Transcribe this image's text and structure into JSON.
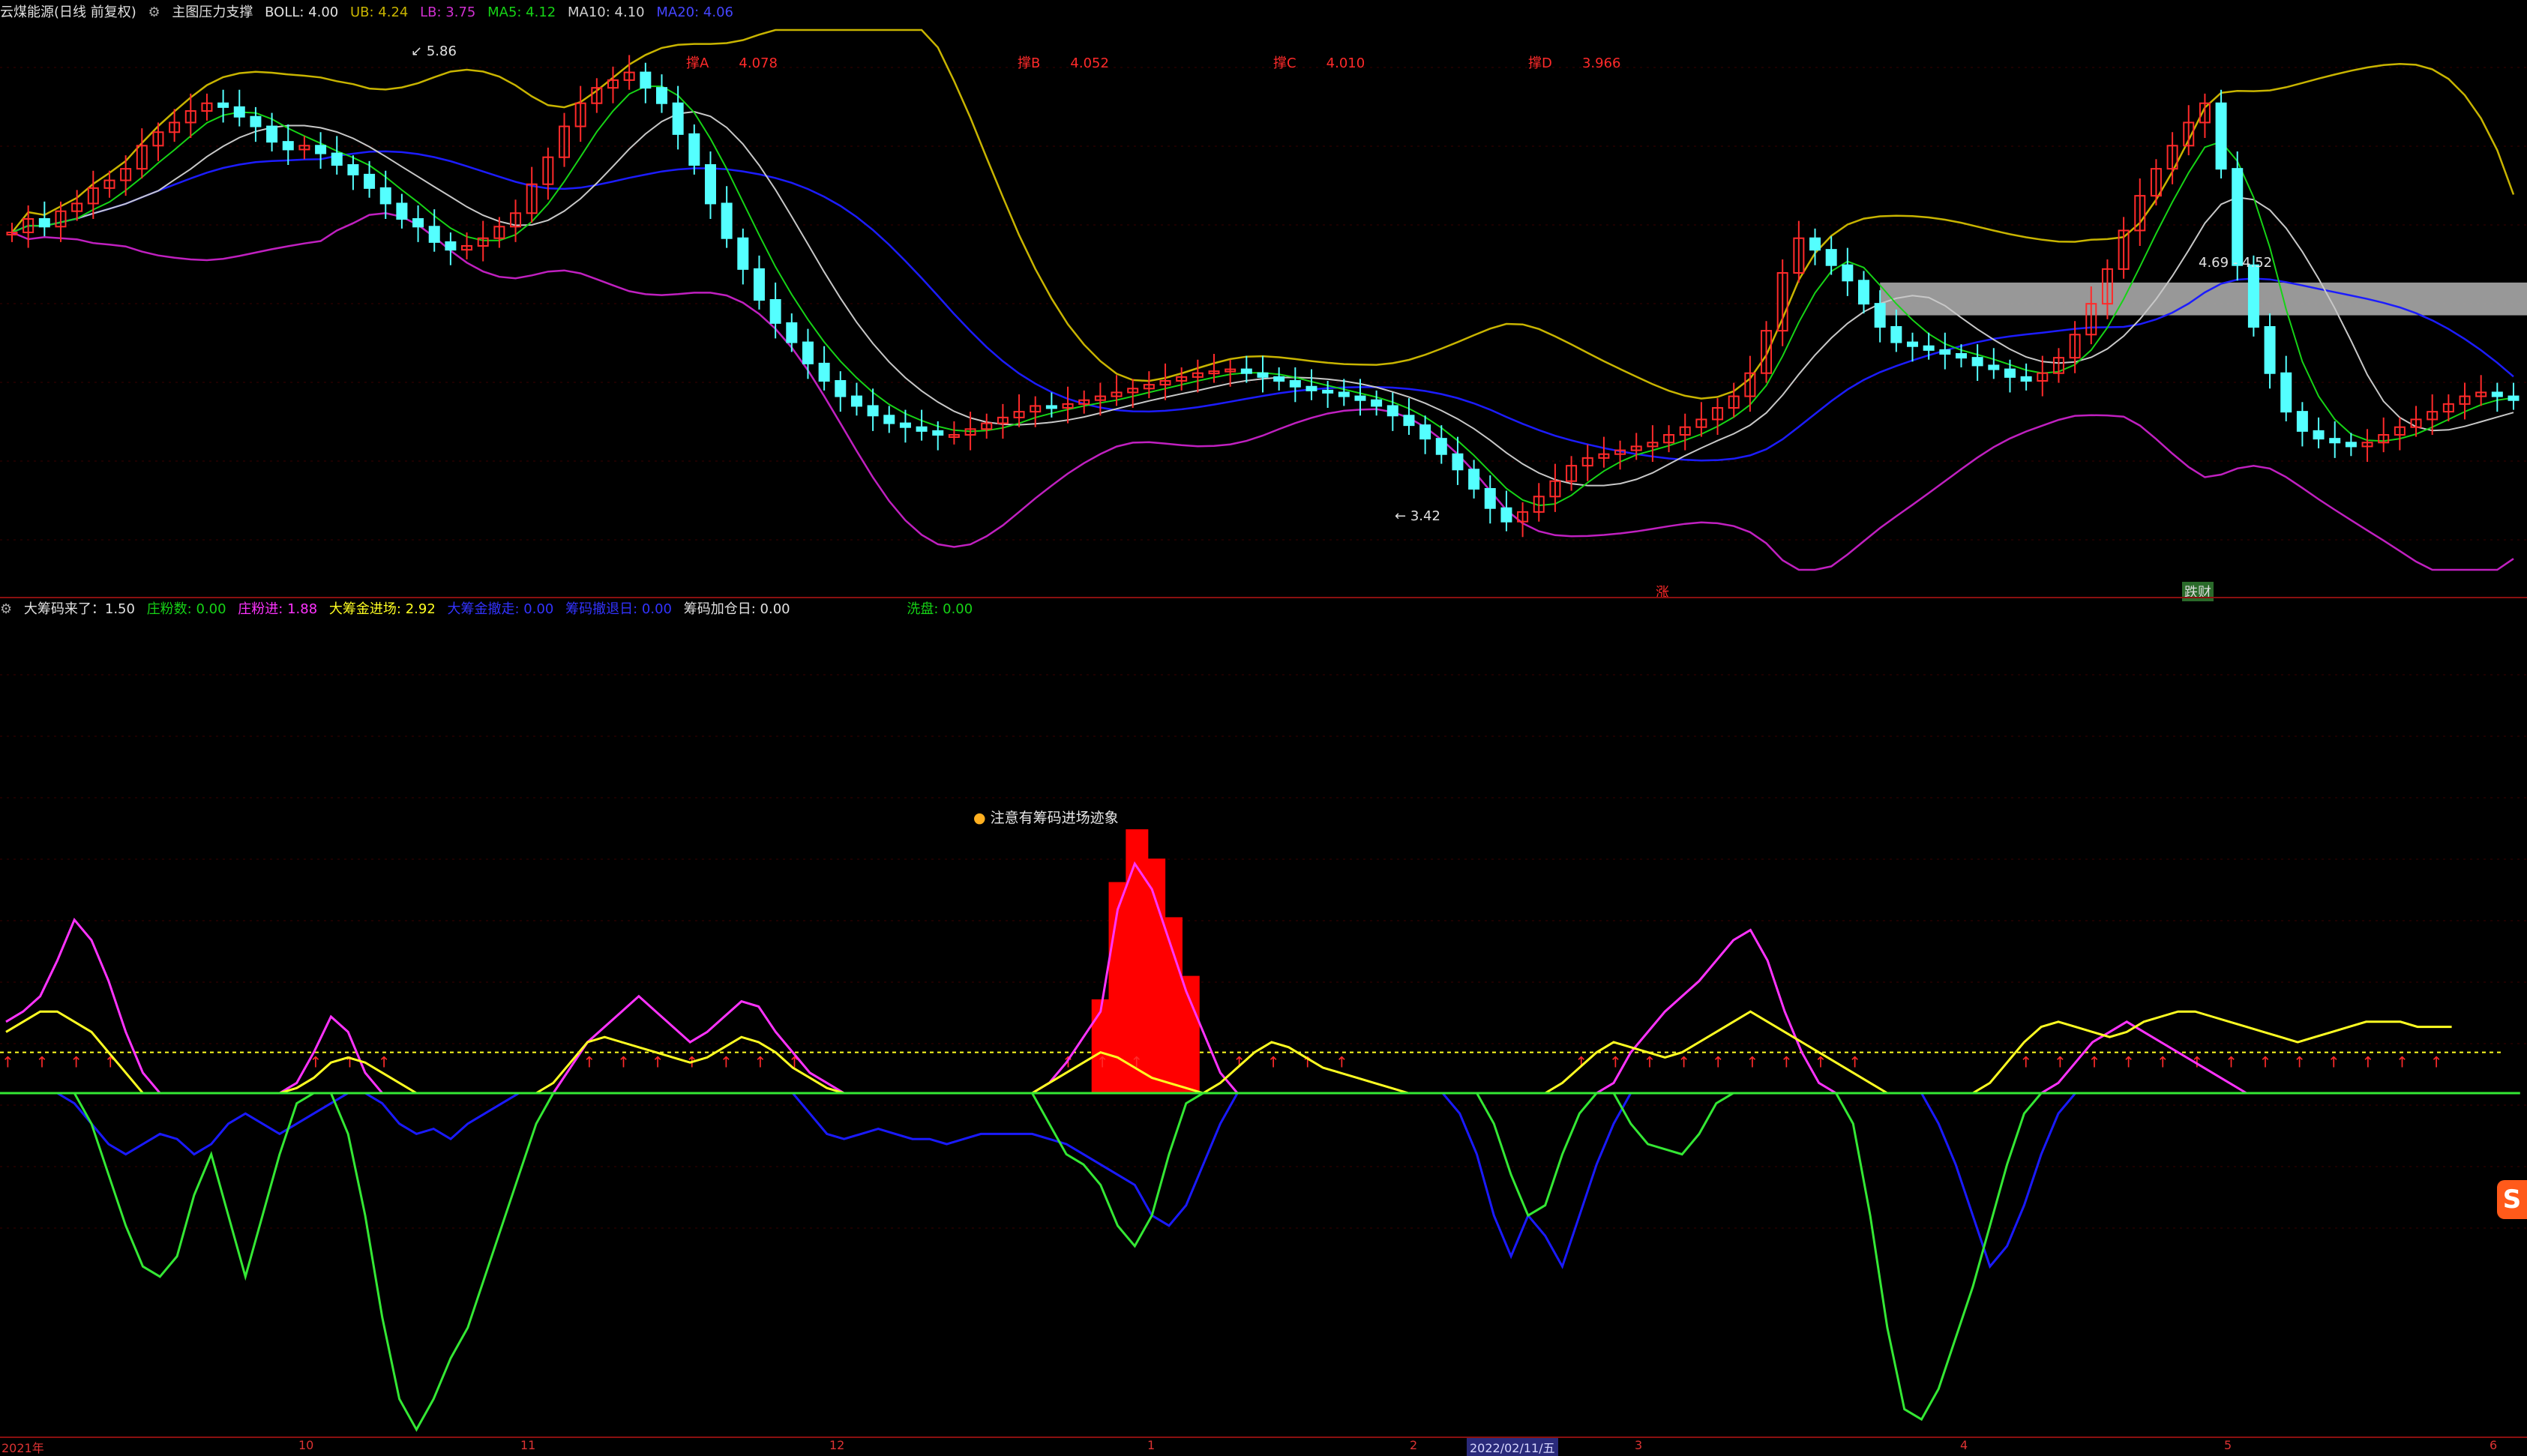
{
  "main_header": {
    "stock": "云煤能源(日线 前复权)",
    "indicator": "主图压力支撑",
    "boll": "BOLL: 4.00",
    "ub": "UB: 4.24",
    "lb": "LB: 3.75",
    "ma5": "MA5: 4.12",
    "ma10": "MA10: 4.10",
    "ma20": "MA20: 4.06"
  },
  "main_tags": [
    {
      "label": "撑A",
      "value": "4.078"
    },
    {
      "label": "撑B",
      "value": "4.052"
    },
    {
      "label": "撑C",
      "value": "4.010"
    },
    {
      "label": "撑D",
      "value": "3.966"
    }
  ],
  "price_annotations": {
    "high": "5.86",
    "low": "3.42",
    "zone": "4.69 - 4.52"
  },
  "signal_markers": {
    "rise": "涨",
    "profit": "跌财"
  },
  "sub_header": {
    "chip": "大筹码来了：1.50",
    "zhuang_count": "庄粉数: 0.00",
    "zhuang_in": "庄粉进: 1.88",
    "big_in": "大筹金进场: 2.92",
    "big_out": "大筹金撤走: 0.00",
    "chip_exit": "筹码撤退日: 0.00",
    "chip_add": "筹码加仓日: 0.00",
    "wash": "洗盘: 0.00"
  },
  "sub_note": "注意有筹码进场迹象",
  "x_axis": {
    "labels": [
      "2021年",
      "10",
      "11",
      "12",
      "1",
      "2",
      "2022/02/11/五",
      "3",
      "4",
      "5",
      "6"
    ],
    "selected": "2022/02/11/五"
  },
  "watermark": "S",
  "colors": {
    "bg": "#000000",
    "up": "#ff2a2a",
    "down": "#54ffff",
    "ma5": "#16d316",
    "ma10": "#c8c8c8",
    "ma20": "#1c1cff",
    "ub": "#c8b400",
    "lb": "#c020c0",
    "chip_bar": "#ff0000",
    "green": "#34e834",
    "yellow": "#ffff22",
    "magenta": "#ff33ff",
    "blue": "#1a1aff"
  },
  "chart_data": [
    {
      "type": "candlestick",
      "title": "云煤能源(日线 前复权)",
      "overlays": [
        "BOLL",
        "UB",
        "LB",
        "MA5",
        "MA10",
        "MA20"
      ],
      "ylim": [
        3.2,
        6.0
      ],
      "annotated_high": 5.86,
      "annotated_low": 3.42,
      "resistance_zone": [
        4.52,
        4.69
      ],
      "support_levels": {
        "撑A": 4.078,
        "撑B": 4.052,
        "撑C": 4.01,
        "撑D": 3.966
      },
      "closes": [
        4.95,
        5.02,
        4.98,
        5.06,
        5.1,
        5.18,
        5.22,
        5.28,
        5.4,
        5.47,
        5.52,
        5.58,
        5.62,
        5.6,
        5.55,
        5.5,
        5.42,
        5.38,
        5.4,
        5.36,
        5.3,
        5.25,
        5.18,
        5.1,
        5.02,
        4.98,
        4.9,
        4.86,
        4.88,
        4.92,
        4.98,
        5.05,
        5.2,
        5.34,
        5.5,
        5.62,
        5.7,
        5.74,
        5.78,
        5.7,
        5.62,
        5.46,
        5.3,
        5.1,
        4.92,
        4.76,
        4.6,
        4.48,
        4.38,
        4.27,
        4.18,
        4.1,
        4.05,
        4.0,
        3.96,
        3.94,
        3.92,
        3.9,
        3.9,
        3.93,
        3.96,
        3.99,
        4.02,
        4.05,
        4.04,
        4.06,
        4.08,
        4.1,
        4.12,
        4.14,
        4.16,
        4.18,
        4.2,
        4.22,
        4.23,
        4.24,
        4.22,
        4.2,
        4.18,
        4.15,
        4.13,
        4.12,
        4.1,
        4.08,
        4.05,
        4.0,
        3.95,
        3.88,
        3.8,
        3.72,
        3.62,
        3.52,
        3.45,
        3.5,
        3.58,
        3.66,
        3.74,
        3.78,
        3.8,
        3.82,
        3.84,
        3.86,
        3.9,
        3.94,
        3.98,
        4.04,
        4.1,
        4.22,
        4.44,
        4.74,
        4.92,
        4.86,
        4.78,
        4.7,
        4.58,
        4.46,
        4.38,
        4.36,
        4.34,
        4.32,
        4.3,
        4.26,
        4.24,
        4.2,
        4.18,
        4.22,
        4.3,
        4.42,
        4.58,
        4.76,
        4.96,
        5.14,
        5.28,
        5.4,
        5.52,
        5.62,
        5.28,
        4.78,
        4.46,
        4.22,
        4.02,
        3.92,
        3.88,
        3.86,
        3.84,
        3.86,
        3.9,
        3.94,
        3.98,
        4.02,
        4.06,
        4.1,
        4.12,
        4.1,
        4.08
      ]
    },
    {
      "type": "line",
      "title": "大筹码来了",
      "baseline": 0,
      "series": [
        {
          "name": "庄粉进",
          "values": [
            1.4,
            1.6,
            1.9,
            2.6,
            3.4,
            3.0,
            2.2,
            1.2,
            0.4,
            0.0,
            0.0,
            0.0,
            0.0,
            0.0,
            0.0,
            0.0,
            0.0,
            0.2,
            0.8,
            1.5,
            1.2,
            0.4,
            0.0,
            0.0,
            0.0,
            0.0,
            0.0,
            0.0,
            0.0,
            0.0,
            0.0,
            0.0,
            0.0,
            0.5,
            1.0,
            1.3,
            1.6,
            1.9,
            1.6,
            1.3,
            1.0,
            1.2,
            1.5,
            1.8,
            1.7,
            1.2,
            0.8,
            0.4,
            0.2,
            0.0,
            0.0,
            0.0,
            0.0,
            0.0,
            0.0,
            0.0,
            0.0,
            0.0,
            0.0,
            0.0,
            0.0,
            0.2,
            0.6,
            1.1,
            1.6,
            3.6,
            4.5,
            4.0,
            3.0,
            2.0,
            1.2,
            0.4,
            0.0,
            0.0,
            0.0,
            0.0,
            0.0,
            0.0,
            0.0,
            0.0,
            0.0,
            0.0,
            0.0,
            0.0,
            0.0,
            0.0,
            0.0,
            0.0,
            0.0,
            0.0,
            0.0,
            0.0,
            0.0,
            0.0,
            0.2,
            0.8,
            1.2,
            1.6,
            1.9,
            2.2,
            2.6,
            3.0,
            3.2,
            2.6,
            1.6,
            0.8,
            0.2,
            0.0,
            0.0,
            0.0,
            0.0,
            0.0,
            0.0,
            0.0,
            0.0,
            0.0,
            0.0,
            0.0,
            0.0,
            0.0,
            0.2,
            0.6,
            1.0,
            1.2,
            1.4,
            1.2,
            1.0,
            0.8,
            0.6,
            0.4,
            0.2,
            0.0,
            0.0,
            0.0,
            0.0,
            0.0,
            0.0,
            0.0,
            0.0,
            0.0,
            0.0,
            0.0,
            0.0,
            0.0,
            0.0,
            0.0,
            0.0
          ]
        },
        {
          "name": "大筹金进场",
          "values": [
            1.2,
            1.4,
            1.6,
            1.6,
            1.4,
            1.2,
            0.8,
            0.4,
            0.0,
            0.0,
            0.0,
            0.0,
            0.0,
            0.0,
            0.0,
            0.0,
            0.0,
            0.1,
            0.3,
            0.6,
            0.7,
            0.6,
            0.4,
            0.2,
            0.0,
            0.0,
            0.0,
            0.0,
            0.0,
            0.0,
            0.0,
            0.0,
            0.2,
            0.6,
            1.0,
            1.1,
            1.0,
            0.9,
            0.8,
            0.7,
            0.6,
            0.7,
            0.9,
            1.1,
            1.0,
            0.8,
            0.5,
            0.3,
            0.1,
            0.0,
            0.0,
            0.0,
            0.0,
            0.0,
            0.0,
            0.0,
            0.0,
            0.0,
            0.0,
            0.0,
            0.0,
            0.2,
            0.4,
            0.6,
            0.8,
            0.7,
            0.5,
            0.3,
            0.2,
            0.1,
            0.0,
            0.2,
            0.5,
            0.8,
            1.0,
            0.9,
            0.7,
            0.5,
            0.4,
            0.3,
            0.2,
            0.1,
            0.0,
            0.0,
            0.0,
            0.0,
            0.0,
            0.0,
            0.0,
            0.0,
            0.0,
            0.2,
            0.5,
            0.8,
            1.0,
            0.9,
            0.8,
            0.7,
            0.8,
            1.0,
            1.2,
            1.4,
            1.6,
            1.4,
            1.2,
            1.0,
            0.8,
            0.6,
            0.4,
            0.2,
            0.0,
            0.0,
            0.0,
            0.0,
            0.0,
            0.0,
            0.2,
            0.6,
            1.0,
            1.3,
            1.4,
            1.3,
            1.2,
            1.1,
            1.2,
            1.4,
            1.5,
            1.6,
            1.6,
            1.5,
            1.4,
            1.3,
            1.2,
            1.1,
            1.0,
            1.1,
            1.2,
            1.3,
            1.4,
            1.4,
            1.4,
            1.3,
            1.3,
            1.3
          ]
        },
        {
          "name": "大筹金撤走",
          "values": [
            0.0,
            0.0,
            0.0,
            0.0,
            -0.2,
            -0.6,
            -1.0,
            -1.2,
            -1.0,
            -0.8,
            -0.9,
            -1.2,
            -1.0,
            -0.6,
            -0.4,
            -0.6,
            -0.8,
            -0.6,
            -0.4,
            -0.2,
            0.0,
            0.0,
            -0.2,
            -0.6,
            -0.8,
            -0.7,
            -0.9,
            -0.6,
            -0.4,
            -0.2,
            0.0,
            0.0,
            0.0,
            0.0,
            0.0,
            0.0,
            0.0,
            0.0,
            0.0,
            0.0,
            0.0,
            0.0,
            0.0,
            0.0,
            0.0,
            0.0,
            0.0,
            -0.4,
            -0.8,
            -0.9,
            -0.8,
            -0.7,
            -0.8,
            -0.9,
            -0.9,
            -1.0,
            -0.9,
            -0.8,
            -0.8,
            -0.8,
            -0.8,
            -0.9,
            -1.0,
            -1.2,
            -1.4,
            -1.6,
            -1.8,
            -2.4,
            -2.6,
            -2.2,
            -1.4,
            -0.6,
            0.0,
            0.0,
            0.0,
            0.0,
            0.0,
            0.0,
            0.0,
            0.0,
            0.0,
            0.0,
            0.0,
            0.0,
            0.0,
            -0.4,
            -1.2,
            -2.4,
            -3.2,
            -2.4,
            -2.8,
            -3.4,
            -2.4,
            -1.4,
            -0.6,
            0.0,
            0.0,
            0.0,
            0.0,
            0.0,
            0.0,
            0.0,
            0.0,
            0.0,
            0.0,
            0.0,
            0.0,
            0.0,
            0.0,
            0.0,
            0.0,
            0.0,
            0.0,
            -0.6,
            -1.4,
            -2.4,
            -3.4,
            -3.0,
            -2.2,
            -1.2,
            -0.4,
            0.0,
            0.0,
            0.0,
            0.0,
            0.0,
            0.0,
            0.0,
            0.0,
            0.0,
            0.0,
            0.0,
            0.0,
            0.0,
            0.0,
            0.0,
            0.0,
            0.0,
            0.0
          ]
        },
        {
          "name": "洗盘",
          "values": [
            0.0,
            0.0,
            0.0,
            0.0,
            0.0,
            -0.6,
            -1.6,
            -2.6,
            -3.4,
            -3.6,
            -3.2,
            -2.0,
            -1.2,
            -2.4,
            -3.6,
            -2.4,
            -1.2,
            -0.2,
            0.0,
            0.0,
            -0.8,
            -2.4,
            -4.4,
            -6.0,
            -6.6,
            -6.0,
            -5.2,
            -4.6,
            -3.6,
            -2.6,
            -1.6,
            -0.6,
            0.0,
            0.0,
            0.0,
            0.0,
            0.0,
            0.0,
            0.0,
            0.0,
            0.0,
            0.0,
            0.0,
            0.0,
            0.0,
            0.0,
            0.0,
            0.0,
            0.0,
            0.0,
            0.0,
            0.0,
            0.0,
            0.0,
            0.0,
            0.0,
            0.0,
            0.0,
            0.0,
            0.0,
            0.0,
            -0.6,
            -1.2,
            -1.4,
            -1.8,
            -2.6,
            -3.0,
            -2.4,
            -1.2,
            -0.2,
            0.0,
            0.0,
            0.0,
            0.0,
            0.0,
            0.0,
            0.0,
            0.0,
            0.0,
            0.0,
            0.0,
            0.0,
            0.0,
            0.0,
            0.0,
            0.0,
            0.0,
            -0.6,
            -1.6,
            -2.4,
            -2.2,
            -1.2,
            -0.4,
            0.0,
            0.0,
            -0.6,
            -1.0,
            -1.1,
            -1.2,
            -0.8,
            -0.2,
            0.0,
            0.0,
            0.0,
            0.0,
            0.0,
            0.0,
            0.0,
            -0.6,
            -2.4,
            -4.6,
            -6.2,
            -6.4,
            -5.8,
            -4.8,
            -3.8,
            -2.6,
            -1.4,
            -0.4,
            0.0,
            0.0,
            0.0,
            0.0,
            0.0,
            0.0,
            0.0,
            0.0,
            0.0,
            0.0,
            0.0,
            0.0,
            0.0,
            0.0,
            0.0,
            0.0,
            0.0,
            0.0,
            0.0,
            0.0,
            0.0,
            0.0,
            0.0,
            0.0,
            0.0,
            0.0,
            0.0,
            0.0,
            0.0
          ]
        }
      ]
    }
  ]
}
